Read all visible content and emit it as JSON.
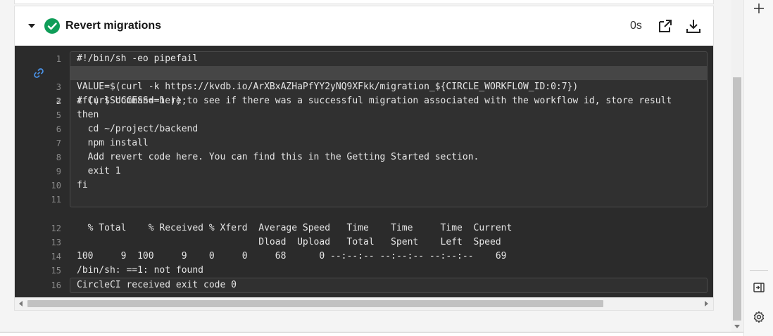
{
  "step": {
    "title": "Revert migrations",
    "duration": "0s",
    "status": "success",
    "status_color": "#0f9d58"
  },
  "terminal": {
    "lines": [
      {
        "num": "1",
        "text": "#!/bin/sh -eo pipefail"
      },
      {
        "num": "2",
        "text": "# Curl command here to see if there was a successful migration associated with the workflow id, store result"
      },
      {
        "num": "3",
        "text": "VALUE=$(curl -k https://kvdb.io/ArXBxAZHaPfYY2yNQ9XFkk/migration_${CIRCLE_WORKFLOW_ID:0:7})"
      },
      {
        "num": "4",
        "text": "if(( $SUCCESS==1 ));"
      },
      {
        "num": "5",
        "text": "then"
      },
      {
        "num": "6",
        "text": "  cd ~/project/backend"
      },
      {
        "num": "7",
        "text": "  npm install"
      },
      {
        "num": "8",
        "text": "  Add revert code here. You can find this in the Getting Started section."
      },
      {
        "num": "9",
        "text": "  exit 1"
      },
      {
        "num": "10",
        "text": "fi"
      },
      {
        "num": "11",
        "text": ""
      },
      {
        "num": "12",
        "text": "  % Total    % Received % Xferd  Average Speed   Time    Time     Time  Current"
      },
      {
        "num": "13",
        "text": "                                 Dload  Upload   Total   Spent    Left  Speed"
      },
      {
        "num": "14",
        "text": "100     9  100     9    0     0     68      0 --:--:-- --:--:-- --:--:--    69"
      },
      {
        "num": "15",
        "text": "/bin/sh: ==1: not found"
      },
      {
        "num": "16",
        "text": "CircleCI received exit code 0"
      }
    ],
    "active_line": "2"
  },
  "icons": {
    "caret": "caret-down-icon",
    "status": "check-circle-icon",
    "open": "open-external-icon",
    "download": "download-icon",
    "link": "link-icon",
    "add": "plus-icon",
    "panel": "panel-expand-icon",
    "settings": "gear-icon"
  }
}
